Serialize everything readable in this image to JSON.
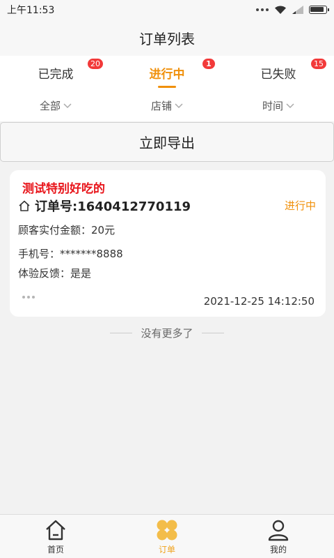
{
  "status_bar": {
    "time": "上午11:53"
  },
  "nav": {
    "title": "订单列表"
  },
  "tabs": [
    {
      "label": "已完成",
      "badge": "20",
      "active": false
    },
    {
      "label": "进行中",
      "badge": "1",
      "active": true
    },
    {
      "label": "已失败",
      "badge": "15",
      "active": false
    }
  ],
  "filters": [
    {
      "label": "全部"
    },
    {
      "label": "店铺"
    },
    {
      "label": "时间"
    }
  ],
  "export_button": {
    "label": "立即导出"
  },
  "order": {
    "shop_name": "测试特别好吃的",
    "order_no": "订单号:1640412770119",
    "status": "进行中",
    "amount": "顾客实付金额：20元",
    "phone": "手机号：*******8888",
    "feedback": "体验反馈：是是",
    "time": "2021-12-25 14:12:50"
  },
  "list_end": {
    "text": "没有更多了"
  },
  "bottom_nav": [
    {
      "label": "首页",
      "icon": "home-icon",
      "active": false
    },
    {
      "label": "订单",
      "icon": "order-icon",
      "active": true
    },
    {
      "label": "我的",
      "icon": "profile-icon",
      "active": false
    }
  ],
  "colors": {
    "accent": "#f0900a",
    "badge": "#f23a3a",
    "shop_name": "#e8141a",
    "tab_active_bottom": "#f0a31e"
  }
}
